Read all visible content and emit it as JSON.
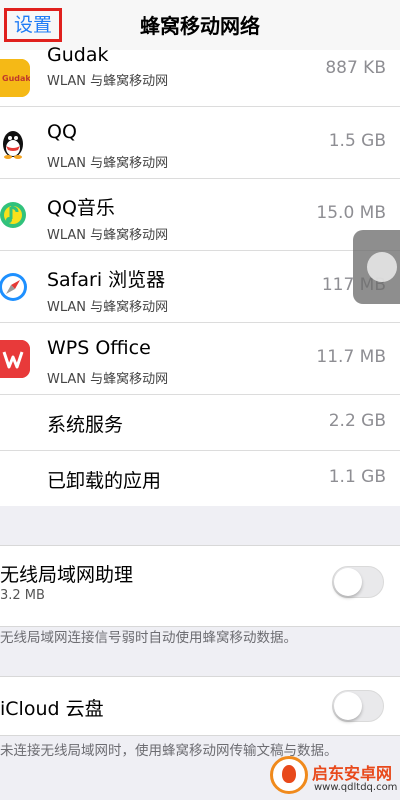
{
  "nav": {
    "back_label": "设置",
    "title": "蜂窝移动网络"
  },
  "apps": [
    {
      "name": "Gudak",
      "sub": "WLAN 与蜂窝移动网",
      "size": "887 KB",
      "icon": "gudak-icon",
      "color": "#f5b916"
    },
    {
      "name": "QQ",
      "sub": "WLAN 与蜂窝移动网",
      "size": "1.5 GB",
      "icon": "qq-penguin-icon",
      "color": "#ffffff"
    },
    {
      "name": "QQ音乐",
      "sub": "WLAN 与蜂窝移动网",
      "size": "15.0 MB",
      "icon": "qq-music-icon",
      "color": "#ffffff"
    },
    {
      "name": "Safari 浏览器",
      "sub": "WLAN 与蜂窝移动网",
      "size": "117 MB",
      "icon": "safari-compass-icon",
      "color": "#1e90ff"
    },
    {
      "name": "WPS Office",
      "sub": "WLAN 与蜂窝移动网",
      "size": "11.7 MB",
      "icon": "wps-office-icon",
      "color": "#e83a3a"
    }
  ],
  "system": {
    "label": "系统服务",
    "size": "2.2 GB"
  },
  "uninstalled": {
    "label": "已卸载的应用",
    "size": "1.1 GB"
  },
  "wifi_assist": {
    "label": "无线局域网助理",
    "usage": "3.2 MB",
    "footnote": "无线局域网连接信号弱时自动使用蜂窝移动数据。"
  },
  "icloud": {
    "label": "iCloud 云盘",
    "footnote": "未连接无线局域网时，使用蜂窝移动网传输文稿与数据。"
  },
  "watermark": {
    "name": "启东安卓网",
    "url": "www.qdltdq.com"
  }
}
